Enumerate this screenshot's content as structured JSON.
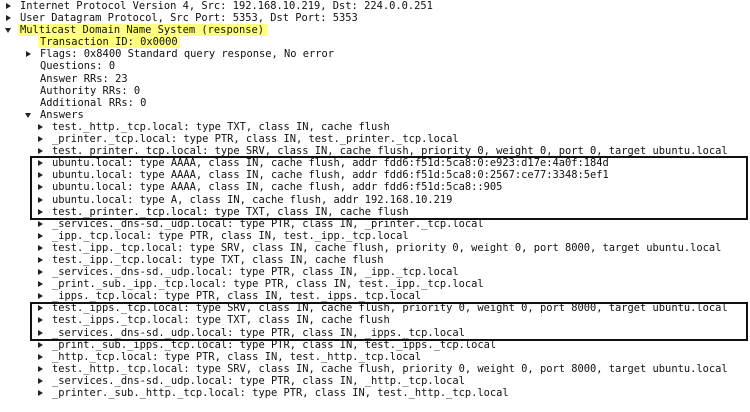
{
  "highlight_color": "#ffff80",
  "rows": [
    {
      "level": 0,
      "expander": "right",
      "text": "Internet Protocol Version 4, Src: 192.168.10.219, Dst: 224.0.0.251"
    },
    {
      "level": 0,
      "expander": "right",
      "text": "User Datagram Protocol, Src Port: 5353, Dst Port: 5353"
    },
    {
      "level": 0,
      "expander": "down",
      "text": "Multicast Domain Name System (response)",
      "highlight": true
    },
    {
      "level": 1,
      "expander": "none",
      "text": "Transaction ID: 0x0000",
      "highlight": true
    },
    {
      "level": 1,
      "expander": "right",
      "text": "Flags: 0x8400 Standard query response, No error"
    },
    {
      "level": 1,
      "expander": "none",
      "text": "Questions: 0"
    },
    {
      "level": 1,
      "expander": "none",
      "text": "Answer RRs: 23"
    },
    {
      "level": 1,
      "expander": "none",
      "text": "Authority RRs: 0"
    },
    {
      "level": 1,
      "expander": "none",
      "text": "Additional RRs: 0"
    },
    {
      "level": 1,
      "expander": "down",
      "text": "Answers"
    },
    {
      "level": 2,
      "expander": "right",
      "text": "test._http._tcp.local: type TXT, class IN, cache flush"
    },
    {
      "level": 2,
      "expander": "right",
      "text": "_printer._tcp.local: type PTR, class IN, test._printer._tcp.local"
    },
    {
      "level": 2,
      "expander": "right",
      "text": "test._printer._tcp.local: type SRV, class IN, cache flush, priority 0, weight 0, port 0, target ubuntu.local"
    },
    {
      "level": 2,
      "expander": "right",
      "text": "ubuntu.local: type AAAA, class IN, cache flush, addr fdd6:f51d:5ca8:0:e923:d17e:4a0f:184d"
    },
    {
      "level": 2,
      "expander": "right",
      "text": "ubuntu.local: type AAAA, class IN, cache flush, addr fdd6:f51d:5ca8:0:2567:ce77:3348:5ef1"
    },
    {
      "level": 2,
      "expander": "right",
      "text": "ubuntu.local: type AAAA, class IN, cache flush, addr fdd6:f51d:5ca8::905"
    },
    {
      "level": 2,
      "expander": "right",
      "text": "ubuntu.local: type A, class IN, cache flush, addr 192.168.10.219"
    },
    {
      "level": 2,
      "expander": "right",
      "text": "test._printer._tcp.local: type TXT, class IN, cache flush"
    },
    {
      "level": 2,
      "expander": "right",
      "text": "_services._dns-sd._udp.local: type PTR, class IN, _printer._tcp.local"
    },
    {
      "level": 2,
      "expander": "right",
      "text": "_ipp._tcp.local: type PTR, class IN, test._ipp._tcp.local"
    },
    {
      "level": 2,
      "expander": "right",
      "text": "test._ipp._tcp.local: type SRV, class IN, cache flush, priority 0, weight 0, port 8000, target ubuntu.local"
    },
    {
      "level": 2,
      "expander": "right",
      "text": "test._ipp._tcp.local: type TXT, class IN, cache flush"
    },
    {
      "level": 2,
      "expander": "right",
      "text": "_services._dns-sd._udp.local: type PTR, class IN, _ipp._tcp.local"
    },
    {
      "level": 2,
      "expander": "right",
      "text": "_print._sub._ipp._tcp.local: type PTR, class IN, test._ipp._tcp.local"
    },
    {
      "level": 2,
      "expander": "right",
      "text": "_ipps._tcp.local: type PTR, class IN, test._ipps._tcp.local"
    },
    {
      "level": 2,
      "expander": "right",
      "text": "test._ipps._tcp.local: type SRV, class IN, cache flush, priority 0, weight 0, port 8000, target ubuntu.local"
    },
    {
      "level": 2,
      "expander": "right",
      "text": "test._ipps._tcp.local: type TXT, class IN, cache flush"
    },
    {
      "level": 2,
      "expander": "right",
      "text": "_services._dns-sd._udp.local: type PTR, class IN, _ipps._tcp.local"
    },
    {
      "level": 2,
      "expander": "right",
      "text": "_print._sub._ipps._tcp.local: type PTR, class IN, test._ipps._tcp.local"
    },
    {
      "level": 2,
      "expander": "right",
      "text": "_http._tcp.local: type PTR, class IN, test._http._tcp.local"
    },
    {
      "level": 2,
      "expander": "right",
      "text": "test._http._tcp.local: type SRV, class IN, cache flush, priority 0, weight 0, port 8000, target ubuntu.local"
    },
    {
      "level": 2,
      "expander": "right",
      "text": "_services._dns-sd._udp.local: type PTR, class IN, _http._tcp.local"
    },
    {
      "level": 2,
      "expander": "right",
      "text": "_printer._sub._http._tcp.local: type PTR, class IN, test._http._tcp.local"
    }
  ],
  "boxes": [
    {
      "from_row": 13,
      "to_row": 17
    },
    {
      "from_row": 25,
      "to_row": 27
    }
  ]
}
